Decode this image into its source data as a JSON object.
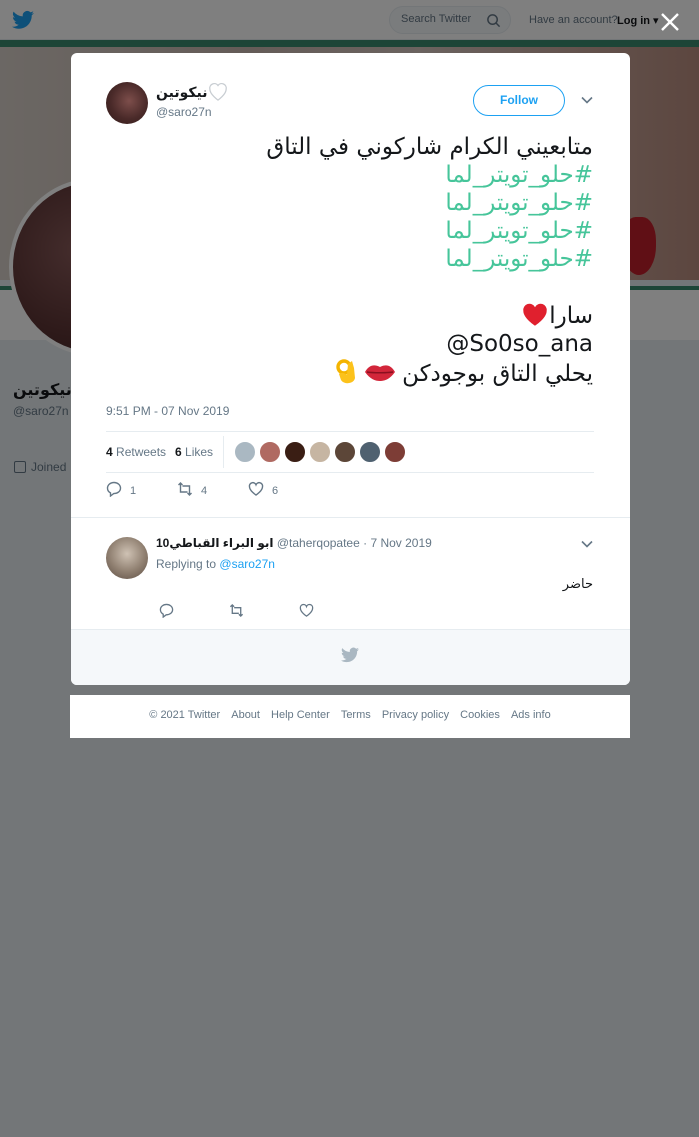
{
  "topbar": {
    "search_placeholder": "Search Twitter",
    "have_account": "Have an account?",
    "login_label": "Log in"
  },
  "profile": {
    "name": "نيكوتين",
    "handle": "@saro27n",
    "joined": "Joined"
  },
  "tweet": {
    "author_name": "نيكوتين",
    "author_handle": "@saro27n",
    "follow_label": "Follow",
    "line1": "متابعيني الكرام شاركوني في التاق",
    "hashtags": [
      "#حلو_تويتر_لما",
      "#حلو_تويتر_لما",
      "#حلو_تويتر_لما",
      "#حلو_تويتر_لما"
    ],
    "name_line": "سارا",
    "mention_line": "@So0so_ana",
    "closing_line": "يحلي التاق بوجودكن",
    "time": "9:51 PM - 07 Nov 2019",
    "retweets_count": "4",
    "retweets_label": "Retweets",
    "likes_count": "6",
    "likes_label": "Likes",
    "reply_count": "1",
    "retweet_action_count": "4",
    "like_action_count": "6"
  },
  "reply": {
    "name": "ابو البراء القباطي10",
    "handle": "@taherqopatee",
    "date": "· 7 Nov 2019",
    "replying_prefix": "Replying to",
    "replying_to": "@saro27n",
    "text": "حاضر"
  },
  "footer": {
    "links": [
      "© 2021 Twitter",
      "About",
      "Help Center",
      "Terms",
      "Privacy policy",
      "Cookies",
      "Ads info"
    ]
  },
  "colors": {
    "brand_blue": "#1da1f2",
    "hashtag_green": "#46c59a",
    "profile_accent": "#3b8a6e"
  },
  "icons": [
    "twitter-bird-icon",
    "search-icon",
    "close-icon",
    "chevron-down-icon",
    "reply-icon",
    "retweet-icon",
    "like-icon",
    "heart-emoji-icon",
    "lips-emoji-icon",
    "ok-hand-emoji-icon",
    "calendar-icon"
  ]
}
